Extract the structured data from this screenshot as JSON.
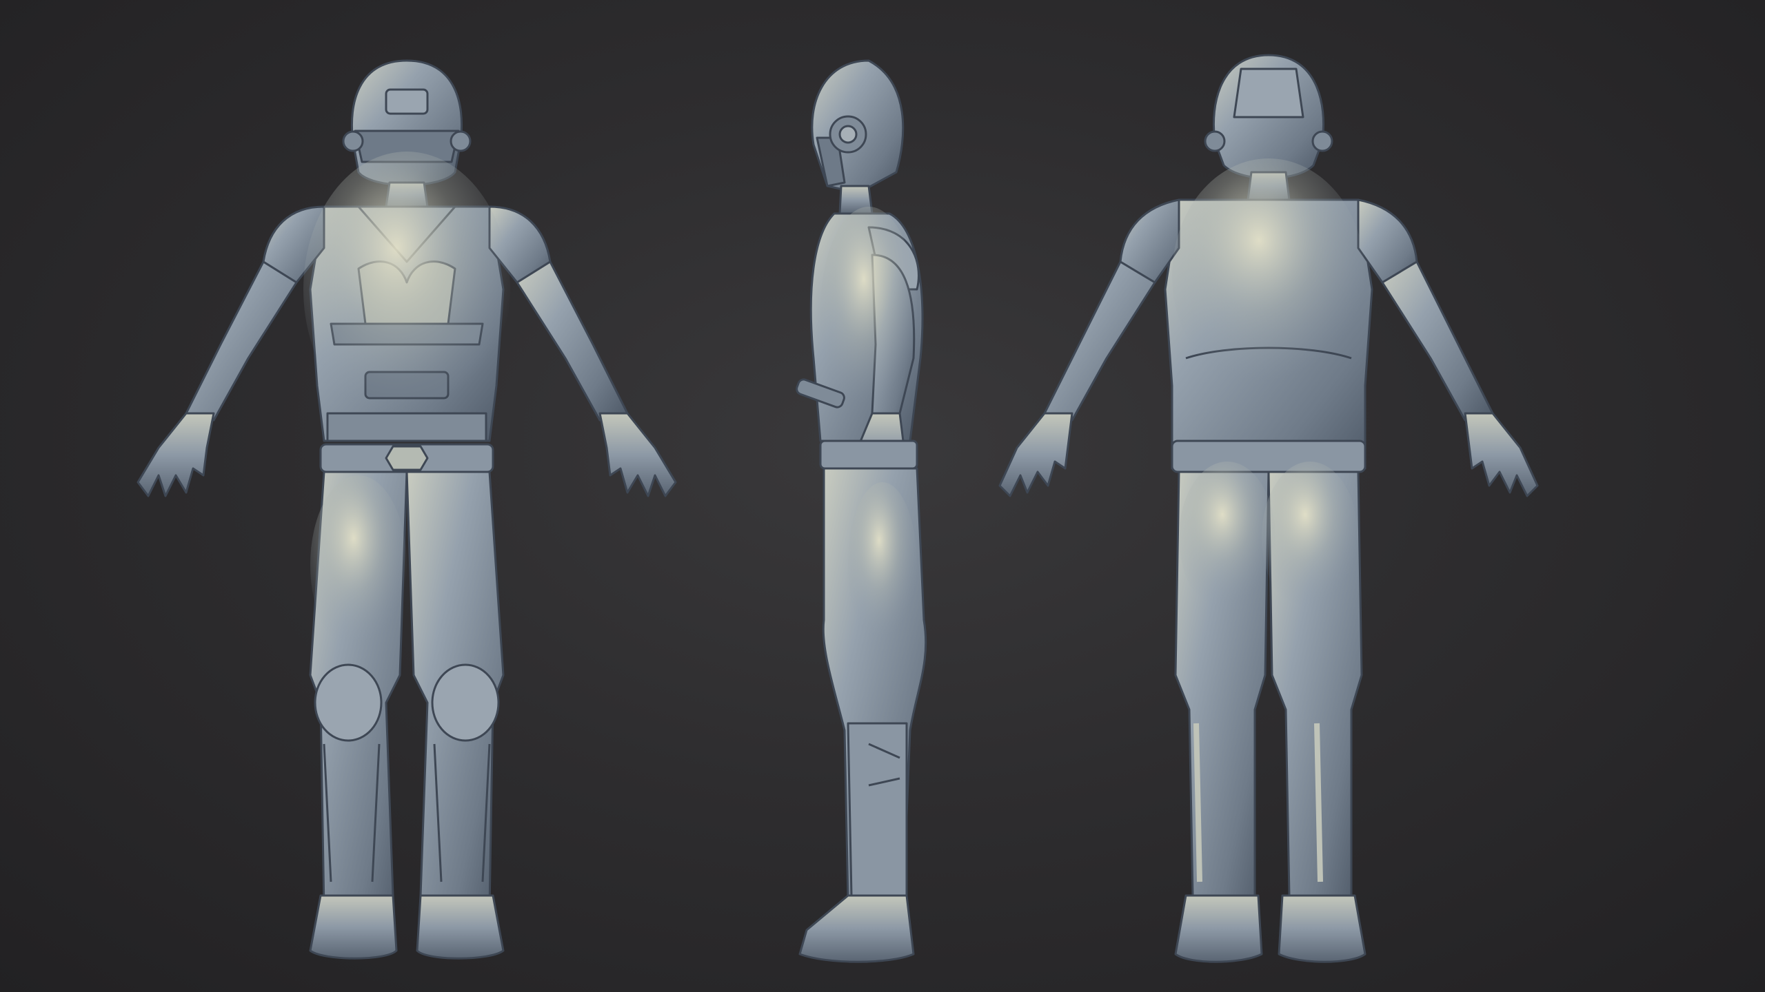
{
  "scene": {
    "background_color": "#2e2d2f",
    "material_color": "#8e9aa6",
    "highlight_color": "#d8d6c0",
    "shadow_color": "#4a5563",
    "views": [
      {
        "id": "front",
        "icon": "character-front-view"
      },
      {
        "id": "side",
        "icon": "character-side-view"
      },
      {
        "id": "back",
        "icon": "character-back-view"
      }
    ]
  }
}
